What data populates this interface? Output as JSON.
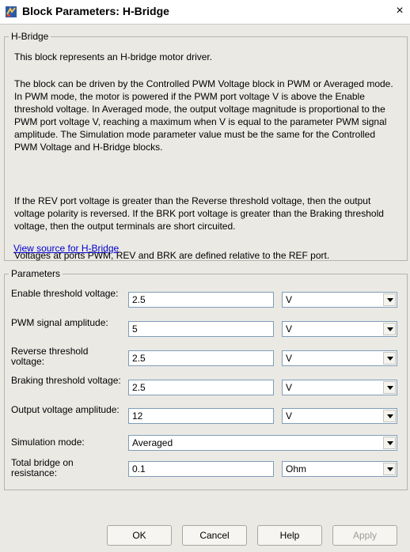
{
  "window": {
    "title": "Block Parameters: H-Bridge",
    "close_glyph": "×"
  },
  "description": {
    "group_title": "H-Bridge",
    "paragraphs": [
      "This block represents an H-bridge motor driver.",
      "The block can be driven by the Controlled PWM Voltage block in PWM or Averaged mode. In PWM mode, the motor is powered if the PWM port voltage V is above the Enable threshold voltage. In Averaged mode, the output voltage magnitude is proportional to the PWM port voltage V, reaching a maximum when V is equal to the parameter PWM signal amplitude. The Simulation mode parameter value must be the same for the Controlled PWM Voltage and H-Bridge blocks.",
      "If the REV port voltage is greater than the Reverse threshold voltage, then the output voltage polarity is reversed. If the BRK port voltage is greater than the Braking threshold voltage, then the output terminals are short circuited.",
      "Voltages at ports PWM, REV and BRK are defined relative to the REF port."
    ],
    "link": "View source for H-Bridge"
  },
  "parameters": {
    "group_title": "Parameters",
    "rows": [
      {
        "label": "Enable threshold voltage:",
        "value": "2.5",
        "unit": "V"
      },
      {
        "label": "PWM signal amplitude:",
        "value": "5",
        "unit": "V"
      },
      {
        "label": "Reverse threshold voltage:",
        "value": "2.5",
        "unit": "V"
      },
      {
        "label": "Braking threshold voltage:",
        "value": "2.5",
        "unit": "V"
      },
      {
        "label": "Output voltage amplitude:",
        "value": "12",
        "unit": "V"
      },
      {
        "label": "Simulation mode:",
        "value": "Averaged"
      },
      {
        "label": "Total bridge on resistance:",
        "value": "0.1",
        "unit": "Ohm"
      }
    ]
  },
  "buttons": {
    "ok": "OK",
    "cancel": "Cancel",
    "help": "Help",
    "apply": "Apply"
  },
  "icons": {
    "window_icon": "simulink-block-icon",
    "dropdown_arrow": "chevron-down-icon"
  },
  "colors": {
    "dialog_background": "#ebe9e4",
    "link": "#0000cc",
    "input_border": "#7f9db9"
  }
}
